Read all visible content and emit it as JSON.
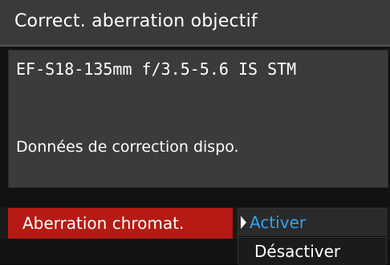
{
  "menu": {
    "title": "Correct. aberration objectif"
  },
  "info": {
    "lens_name": "EF-S18-135mm f/3.5-5.6 IS STM",
    "correction_status": "Données de correction dispo."
  },
  "setting": {
    "label": "Aberration chromat.",
    "options": [
      {
        "label": "Activer",
        "selected": true
      },
      {
        "label": "Désactiver",
        "selected": false
      }
    ]
  },
  "colors": {
    "highlight": "#b61a14",
    "selected_option": "#31a3ee",
    "panel": "#3b3b3b"
  },
  "icons": {
    "selection_cursor": "triangle-right"
  }
}
